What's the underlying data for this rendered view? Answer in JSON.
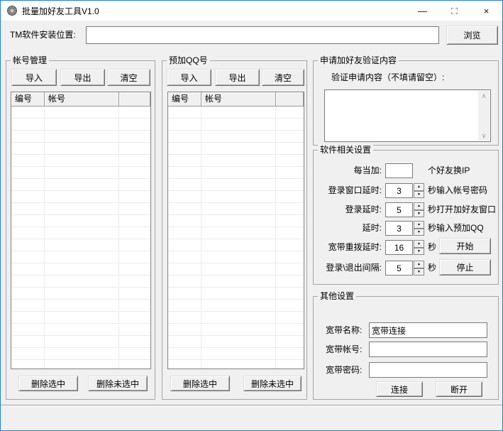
{
  "window": {
    "title": "批量加好友工具V1.0",
    "controls": {
      "minimize": "—",
      "close": "×"
    }
  },
  "install_path": {
    "label": "TM软件安装位置:",
    "value": "",
    "browse_label": "浏览"
  },
  "account_panel": {
    "title": "帐号管理",
    "import_label": "导入",
    "export_label": "导出",
    "clear_label": "清空",
    "columns": [
      "编号",
      "帐号",
      ""
    ],
    "rows": [],
    "delete_selected_label": "删除选中",
    "delete_unselected_label": "删除未选中"
  },
  "preadd_panel": {
    "title": "预加QQ号",
    "import_label": "导入",
    "export_label": "导出",
    "clear_label": "清空",
    "columns": [
      "编号",
      "帐号",
      ""
    ],
    "rows": [],
    "delete_selected_label": "删除选中",
    "delete_unselected_label": "删除未选中"
  },
  "verify_panel": {
    "title": "申请加好友验证内容",
    "label": "验证申请内容（不填请留空）:",
    "value": ""
  },
  "settings_panel": {
    "title": "软件相关设置",
    "rows": [
      {
        "label": "每当加:",
        "value": "",
        "suffix": "个好友换IP"
      },
      {
        "label": "登录窗口延时:",
        "value": "3",
        "suffix": "秒输入帐号密码"
      },
      {
        "label": "登录延时:",
        "value": "5",
        "suffix": "秒打开加好友窗口"
      },
      {
        "label": "延时:",
        "value": "3",
        "suffix": "秒输入预加QQ"
      },
      {
        "label": "宽带重拨延时:",
        "value": "16",
        "suffix": "秒"
      },
      {
        "label": "登录\\退出间隔:",
        "value": "5",
        "suffix": "秒"
      }
    ],
    "start_label": "开始",
    "stop_label": "停止"
  },
  "other_panel": {
    "title": "其他设置",
    "fields": [
      {
        "label": "宽带名称:",
        "value": "宽带连接"
      },
      {
        "label": "宽带帐号:",
        "value": ""
      },
      {
        "label": "宽带密码:",
        "value": ""
      }
    ],
    "connect_label": "连接",
    "disconnect_label": "断开"
  },
  "colors": {
    "window_border": "#2a7cc4",
    "dialog_bg": "#f0f0f0",
    "titlebar_bg": "#ffffff"
  }
}
